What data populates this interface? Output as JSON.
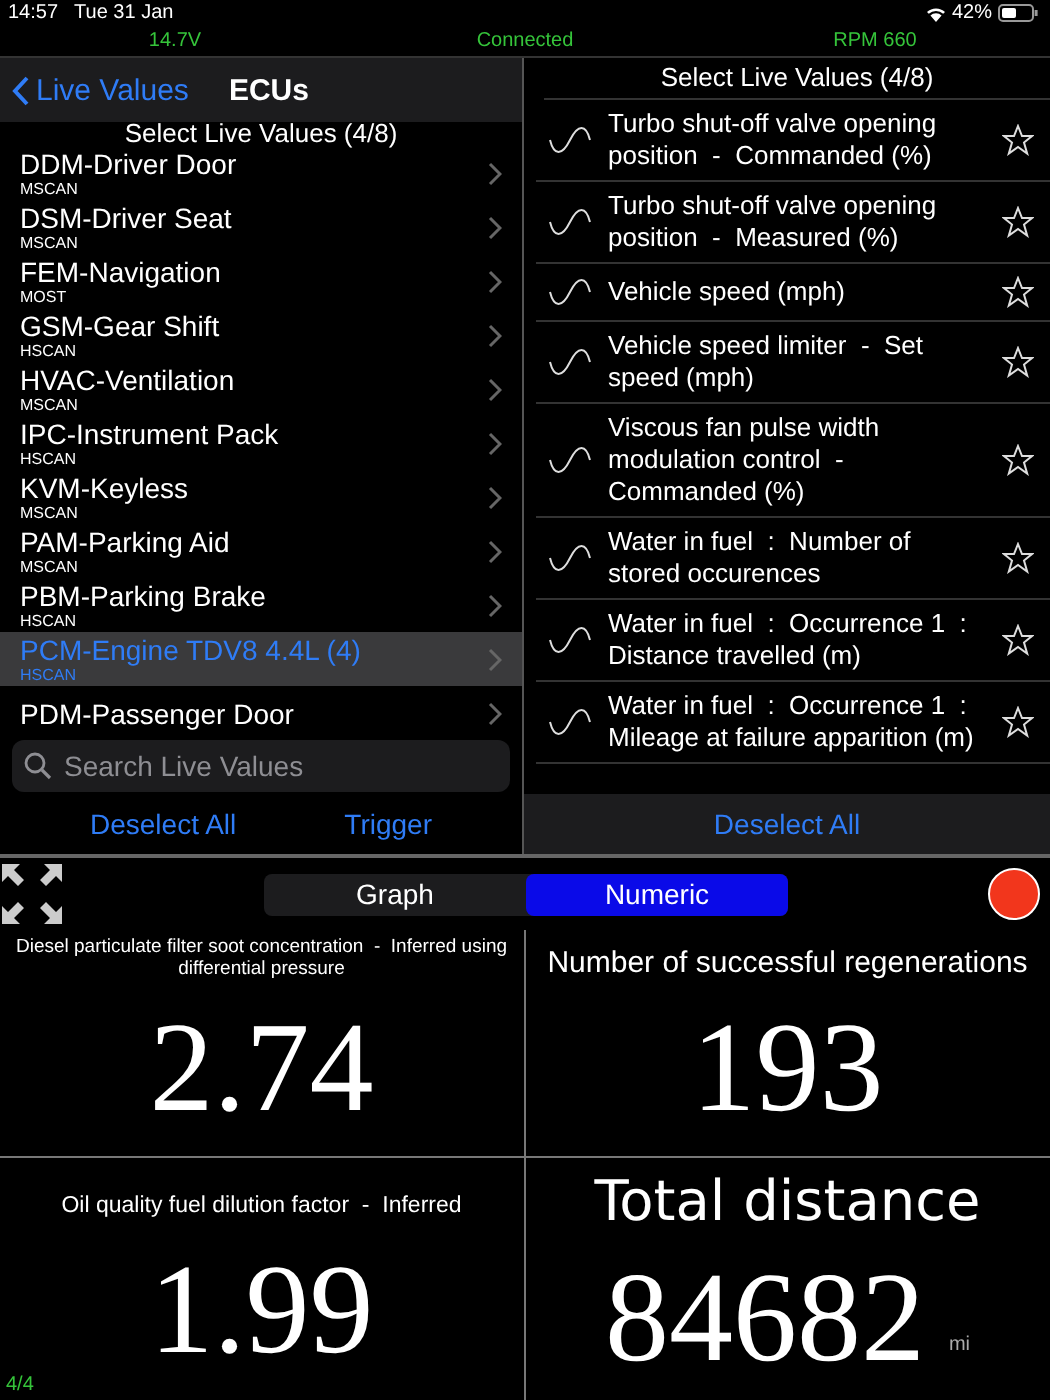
{
  "status_bar": {
    "time": "14:57",
    "date": "Tue 31 Jan",
    "battery": "42%"
  },
  "vehicle_bar": {
    "voltage": "14.7V",
    "connection": "Connected",
    "rpm": "RPM 660"
  },
  "ecu_panel": {
    "back": "Live Values",
    "title": "ECUs",
    "subtitle": "Select Live Values (4/8)",
    "items": [
      {
        "name": "DDM-Driver Door",
        "bus": "MSCAN",
        "selected": false
      },
      {
        "name": "DSM-Driver Seat",
        "bus": "MSCAN",
        "selected": false
      },
      {
        "name": "FEM-Navigation",
        "bus": "MOST",
        "selected": false
      },
      {
        "name": "GSM-Gear Shift",
        "bus": "HSCAN",
        "selected": false
      },
      {
        "name": "HVAC-Ventilation",
        "bus": "MSCAN",
        "selected": false
      },
      {
        "name": "IPC-Instrument Pack",
        "bus": "HSCAN",
        "selected": false
      },
      {
        "name": "KVM-Keyless",
        "bus": "MSCAN",
        "selected": false
      },
      {
        "name": "PAM-Parking Aid",
        "bus": "MSCAN",
        "selected": false
      },
      {
        "name": "PBM-Parking Brake",
        "bus": "HSCAN",
        "selected": false
      },
      {
        "name": "PCM-Engine TDV8 4.4L (4)",
        "bus": "HSCAN",
        "selected": true
      },
      {
        "name": "PDM-Passenger Door",
        "selected": false
      }
    ],
    "search": {
      "placeholder": "Search Live Values"
    },
    "buttons": [
      "Deselect All",
      "Trigger"
    ]
  },
  "values_panel": {
    "title": "Select Live Values (4/8)",
    "items": [
      {
        "label": "Turbo shut-off valve opening position  -  Commanded (%)",
        "favorite": false
      },
      {
        "label": "Turbo shut-off valve opening position  -  Measured (%)",
        "favorite": false
      },
      {
        "label": "Vehicle speed (mph)",
        "favorite": false
      },
      {
        "label": "Vehicle speed limiter  -  Set speed (mph)",
        "favorite": false
      },
      {
        "label": "Viscous fan pulse width modulation control  -  Commanded (%)",
        "favorite": false
      },
      {
        "label": "Water in fuel  :  Number of stored occurences",
        "favorite": false
      },
      {
        "label": "Water in fuel  :  Occurrence 1  :  Distance travelled (m)",
        "favorite": false
      },
      {
        "label": "Water in fuel  :  Occurrence 1  :  Mileage at failure apparition (m)",
        "favorite": false
      }
    ],
    "button": "Deselect All"
  },
  "dashboard": {
    "modes": [
      {
        "label": "Graph",
        "selected": false
      },
      {
        "label": "Numeric",
        "selected": true
      }
    ],
    "recording": true,
    "tiles": [
      {
        "label": "Diesel particulate filter soot concentration  -  Inferred using differential pressure",
        "value": "2.74"
      },
      {
        "label": "Number of successful regenerations",
        "value": "193"
      },
      {
        "label": "Oil quality fuel dilution factor  -  Inferred",
        "value": "1.99"
      },
      {
        "label": "Total distance",
        "value": "84682",
        "unit": "mi"
      }
    ],
    "page": "4/4"
  }
}
